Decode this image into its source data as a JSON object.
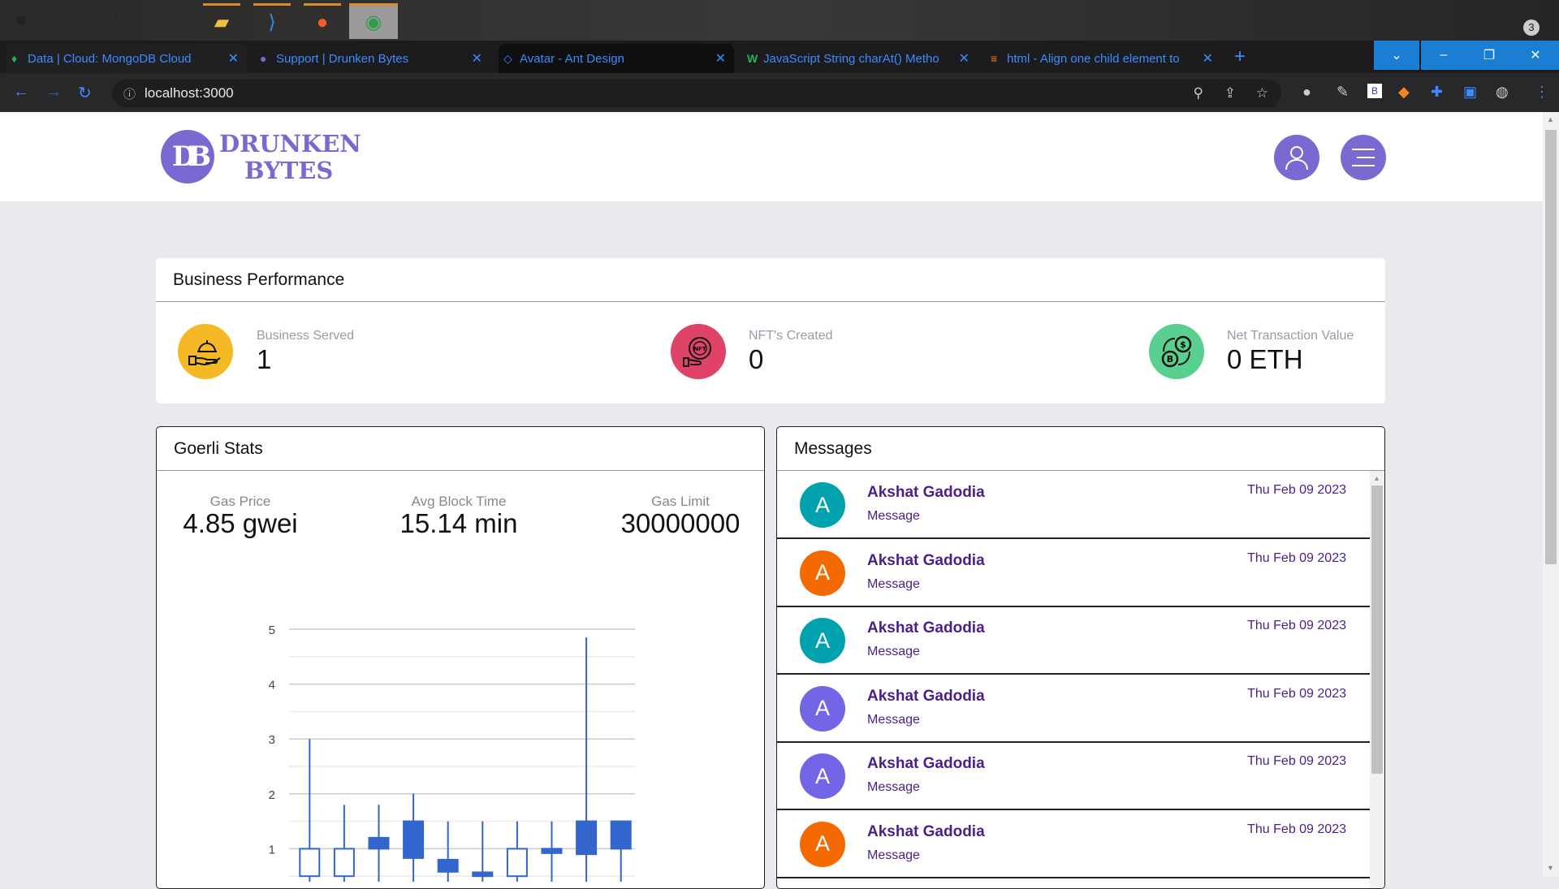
{
  "browser": {
    "tabs": [
      {
        "label": "Data | Cloud: MongoDB Cloud",
        "icon": "mongodb-leaf-icon"
      },
      {
        "label": "Support | Drunken Bytes",
        "icon": "drunken-bytes-icon"
      },
      {
        "label": "Avatar - Ant Design",
        "icon": "ant-design-icon"
      },
      {
        "label": "JavaScript String charAt() Metho",
        "icon": "w3schools-icon"
      },
      {
        "label": "html - Align one child element to",
        "icon": "stackoverflow-icon"
      }
    ],
    "url": "localhost:3000",
    "taskbar_badge": "3"
  },
  "header": {
    "logo_line1": "DRUNKEN",
    "logo_line2": "BYTES",
    "logo_mark": "DB"
  },
  "business": {
    "title": "Business Performance",
    "stats": [
      {
        "label": "Business Served",
        "value": "1",
        "color": "#f6b926",
        "icon": "serving-hand-icon"
      },
      {
        "label": "NFT's Created",
        "value": "0",
        "color": "#e04368",
        "icon": "nft-hand-icon"
      },
      {
        "label": "Net Transaction Value",
        "value": "0 ETH",
        "color": "#59d08f",
        "icon": "crypto-exchange-icon"
      }
    ]
  },
  "goerli": {
    "title": "Goerli Stats",
    "stats": [
      {
        "label": "Gas Price",
        "value": "4.85 gwei"
      },
      {
        "label": "Avg Block Time",
        "value": "15.14 min"
      },
      {
        "label": "Gas Limit",
        "value": "30000000"
      }
    ]
  },
  "chart_data": {
    "type": "candlestick",
    "yticks": [
      "1",
      "2",
      "3",
      "4",
      "5"
    ],
    "ylim": [
      0,
      5
    ],
    "grid": true,
    "color": "#3366cc",
    "candles": [
      {
        "open": 0.5,
        "close": 1.0,
        "high": 3.0,
        "low": 0.2
      },
      {
        "open": 0.5,
        "close": 1.0,
        "high": 1.8,
        "low": 0.2
      },
      {
        "open": 1.2,
        "close": 1.0,
        "high": 1.8,
        "low": 0.2
      },
      {
        "open": 1.5,
        "close": 0.83,
        "high": 2.0,
        "low": 0.2
      },
      {
        "open": 0.8,
        "close": 0.58,
        "high": 1.5,
        "low": 0.2
      },
      {
        "open": 0.57,
        "close": 0.5,
        "high": 1.5,
        "low": 0.2
      },
      {
        "open": 0.5,
        "close": 1.0,
        "high": 1.5,
        "low": 0.2
      },
      {
        "open": 1.0,
        "close": 0.92,
        "high": 1.5,
        "low": 0.2
      },
      {
        "open": 1.5,
        "close": 0.9,
        "high": 4.85,
        "low": 0.2
      },
      {
        "open": 1.5,
        "close": 1.0,
        "high": 1.5,
        "low": 0.2
      }
    ]
  },
  "messages": {
    "title": "Messages",
    "items": [
      {
        "initial": "A",
        "name": "Akshat Gadodia",
        "text": "Message",
        "date": "Thu Feb 09 2023",
        "color": "#00a2ae"
      },
      {
        "initial": "A",
        "name": "Akshat Gadodia",
        "text": "Message",
        "date": "Thu Feb 09 2023",
        "color": "#f56a00"
      },
      {
        "initial": "A",
        "name": "Akshat Gadodia",
        "text": "Message",
        "date": "Thu Feb 09 2023",
        "color": "#00a2ae"
      },
      {
        "initial": "A",
        "name": "Akshat Gadodia",
        "text": "Message",
        "date": "Thu Feb 09 2023",
        "color": "#7265e6"
      },
      {
        "initial": "A",
        "name": "Akshat Gadodia",
        "text": "Message",
        "date": "Thu Feb 09 2023",
        "color": "#7265e6"
      },
      {
        "initial": "A",
        "name": "Akshat Gadodia",
        "text": "Message",
        "date": "Thu Feb 09 2023",
        "color": "#f56a00"
      }
    ]
  }
}
